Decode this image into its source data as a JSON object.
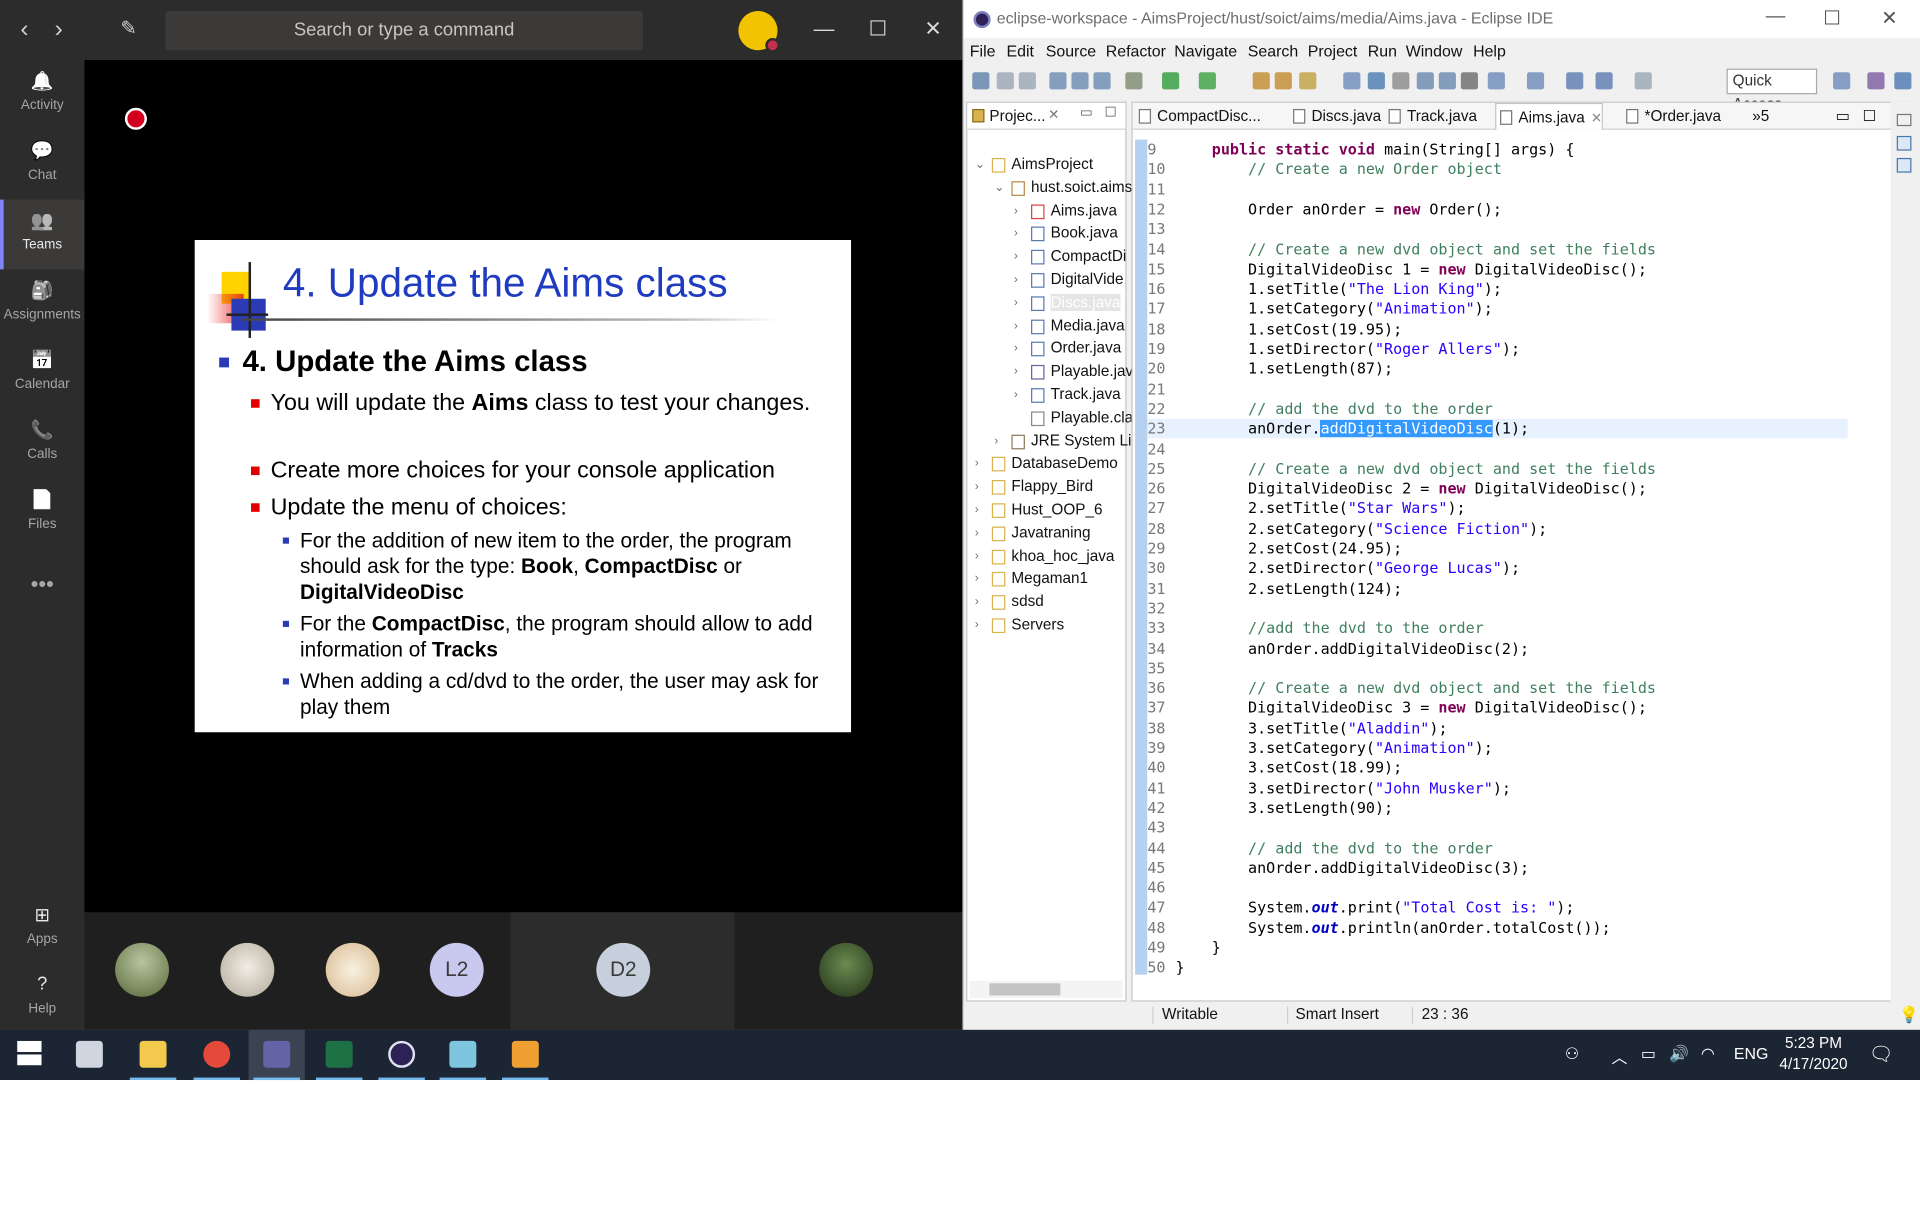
{
  "teams": {
    "search_placeholder": "Search or type a command",
    "rail": [
      {
        "label": "Activity",
        "icon": "bell-icon"
      },
      {
        "label": "Chat",
        "icon": "chat-icon"
      },
      {
        "label": "Teams",
        "icon": "teams-icon"
      },
      {
        "label": "Assignments",
        "icon": "assignments-icon"
      },
      {
        "label": "Calendar",
        "icon": "calendar-icon"
      },
      {
        "label": "Calls",
        "icon": "phone-icon"
      },
      {
        "label": "Files",
        "icon": "files-icon"
      },
      {
        "label": "Apps",
        "icon": "apps-icon"
      },
      {
        "label": "Help",
        "icon": "help-icon"
      }
    ],
    "participants": {
      "l2": "L2",
      "d2": "D2"
    },
    "slide": {
      "title": "4. Update the Aims class",
      "h1": "4. Update the Aims class",
      "b1_pre": "You will update the ",
      "b1_bold": "Aims",
      "b1_post": " class to test your changes.",
      "b2": "Create more choices for your console application",
      "b3": "Update the menu of choices:",
      "c1_pre": "For the addition of new item to the order, the program should ask for the type: ",
      "c1_b1": "Book",
      "c1_mid1": ", ",
      "c1_b2": "CompactDisc",
      "c1_mid2": " or ",
      "c1_b3": "DigitalVideoDisc",
      "c2_pre": "For the ",
      "c2_b1": "CompactDisc",
      "c2_mid": ", the program should allow to add information of ",
      "c2_b2": "Tracks",
      "c3": "When adding a cd/dvd to the order, the user may ask for play them"
    }
  },
  "eclipse": {
    "title": "eclipse-workspace - AimsProject/hust/soict/aims/media/Aims.java - Eclipse IDE",
    "menu": [
      "File",
      "Edit",
      "Source",
      "Refactor",
      "Navigate",
      "Search",
      "Project",
      "Run",
      "Window",
      "Help"
    ],
    "quick_access": "Quick Access",
    "explorer_tab": "Projec...",
    "tree": [
      {
        "label": "AimsProject"
      },
      {
        "label": "hust.soict.aims"
      },
      {
        "label": "Aims.java"
      },
      {
        "label": "Book.java"
      },
      {
        "label": "CompactDi"
      },
      {
        "label": "DigitalVide"
      },
      {
        "label": "Discs.java"
      },
      {
        "label": "Media.java"
      },
      {
        "label": "Order.java"
      },
      {
        "label": "Playable.jav"
      },
      {
        "label": "Track.java"
      },
      {
        "label": "Playable.cla"
      },
      {
        "label": "JRE System Lib"
      },
      {
        "label": "DatabaseDemo"
      },
      {
        "label": "Flappy_Bird"
      },
      {
        "label": "Hust_OOP_6"
      },
      {
        "label": "Javatraning"
      },
      {
        "label": "khoa_hoc_java"
      },
      {
        "label": "Megaman1"
      },
      {
        "label": "sdsd"
      },
      {
        "label": "Servers"
      }
    ],
    "tabs": [
      "CompactDisc...",
      "Discs.java",
      "Track.java",
      "Aims.java",
      "*Order.java"
    ],
    "tabs_overflow": "»5",
    "status": {
      "mode": "Writable",
      "insert": "Smart Insert",
      "position": "23 : 36"
    }
  },
  "code": [
    {
      "n": "9",
      "t": "    public static void main(String[] args) {"
    },
    {
      "n": "10",
      "t": "        // Create a new Order object"
    },
    {
      "n": "11",
      "t": ""
    },
    {
      "n": "12",
      "t": "        Order anOrder = new Order();"
    },
    {
      "n": "13",
      "t": ""
    },
    {
      "n": "14",
      "t": "        // Create a new dvd object and set the fields"
    },
    {
      "n": "15",
      "t": "        DigitalVideoDisc dvd1 = new DigitalVideoDisc();"
    },
    {
      "n": "16",
      "t": "        dvd1.setTitle(\"The Lion King\");"
    },
    {
      "n": "17",
      "t": "        dvd1.setCategory(\"Animation\");"
    },
    {
      "n": "18",
      "t": "        dvd1.setCost(19.95f);"
    },
    {
      "n": "19",
      "t": "        dvd1.setDirector(\"Roger Allers\");"
    },
    {
      "n": "20",
      "t": "        dvd1.setLength(87);"
    },
    {
      "n": "21",
      "t": ""
    },
    {
      "n": "22",
      "t": "        // add the dvd to the order"
    },
    {
      "n": "23",
      "t": "        anOrder.addDigitalVideoDisc(dvd1);"
    },
    {
      "n": "24",
      "t": ""
    },
    {
      "n": "25",
      "t": "        // Create a new dvd object and set the fields"
    },
    {
      "n": "26",
      "t": "        DigitalVideoDisc dvd2 = new DigitalVideoDisc();"
    },
    {
      "n": "27",
      "t": "        dvd2.setTitle(\"Star Wars\");"
    },
    {
      "n": "28",
      "t": "        dvd2.setCategory(\"Science Fiction\");"
    },
    {
      "n": "29",
      "t": "        dvd2.setCost(24.95f);"
    },
    {
      "n": "30",
      "t": "        dvd2.setDirector(\"George Lucas\");"
    },
    {
      "n": "31",
      "t": "        dvd2.setLength(124);"
    },
    {
      "n": "32",
      "t": ""
    },
    {
      "n": "33",
      "t": "        //add the dvd to the order"
    },
    {
      "n": "34",
      "t": "        anOrder.addDigitalVideoDisc(dvd2);"
    },
    {
      "n": "35",
      "t": ""
    },
    {
      "n": "36",
      "t": "        // Create a new dvd object and set the fields"
    },
    {
      "n": "37",
      "t": "        DigitalVideoDisc dvd3 = new DigitalVideoDisc();"
    },
    {
      "n": "38",
      "t": "        dvd3.setTitle(\"Aladdin\");"
    },
    {
      "n": "39",
      "t": "        dvd3.setCategory(\"Animation\");"
    },
    {
      "n": "40",
      "t": "        dvd3.setCost(18.99f);"
    },
    {
      "n": "41",
      "t": "        dvd3.setDirector(\"John Musker\");"
    },
    {
      "n": "42",
      "t": "        dvd3.setLength(90);"
    },
    {
      "n": "43",
      "t": ""
    },
    {
      "n": "44",
      "t": "        // add the dvd to the order"
    },
    {
      "n": "45",
      "t": "        anOrder.addDigitalVideoDisc(dvd3);"
    },
    {
      "n": "46",
      "t": ""
    },
    {
      "n": "47",
      "t": "        System.out.print(\"Total Cost is: \");"
    },
    {
      "n": "48",
      "t": "        System.out.println(anOrder.totalCost());"
    },
    {
      "n": "49",
      "t": "    }"
    },
    {
      "n": "50",
      "t": "}"
    }
  ],
  "taskbar": {
    "apps": [
      "windows-start-icon",
      "task-view-icon",
      "file-explorer-icon",
      "chrome-icon",
      "teams-icon",
      "excel-icon",
      "eclipse-icon",
      "notepad-icon",
      "paint-icon"
    ],
    "language": "ENG",
    "time": "5:23 PM",
    "date": "4/17/2020"
  },
  "colors": {
    "teams_accent": "#7f85f5",
    "slide_title": "#1f3bbf",
    "java_keyword": "#7f0055",
    "java_comment": "#3f7f5f",
    "java_string": "#2a00ff",
    "selection": "#3399ff",
    "taskbar": "#1c2533"
  }
}
